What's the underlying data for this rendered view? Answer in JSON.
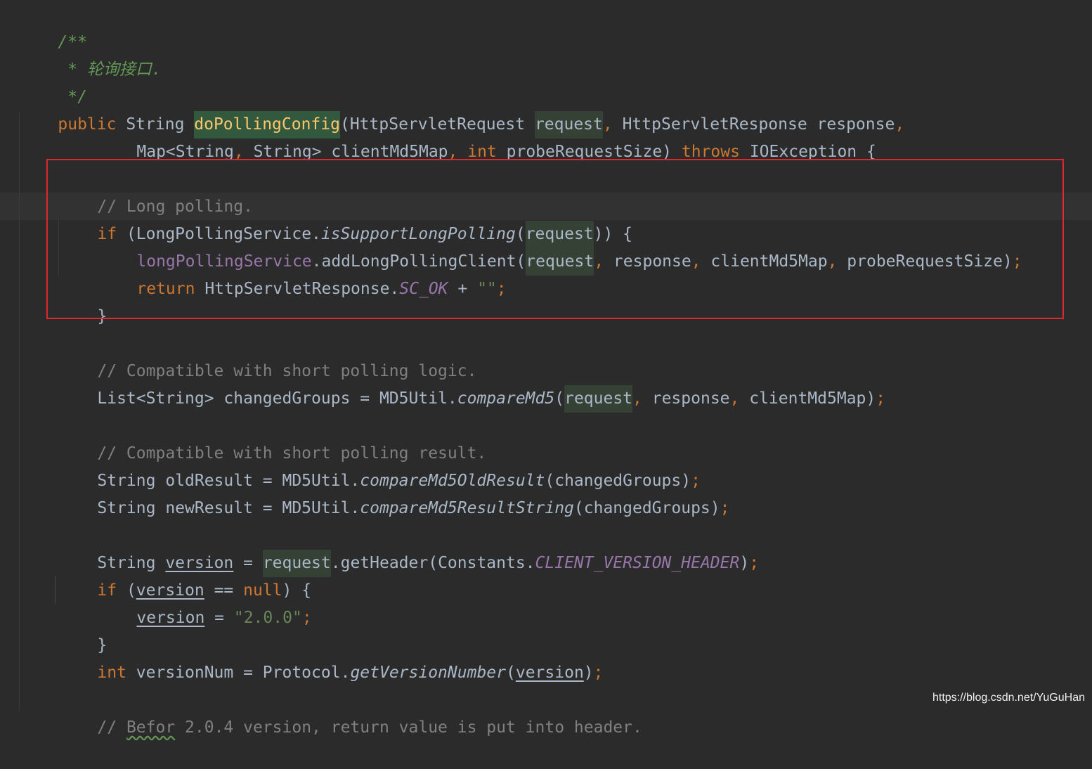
{
  "code": {
    "doc_open": "/**",
    "doc_desc": " * 轮询接口.",
    "doc_close": " */",
    "sig1": {
      "public": "public",
      "string_type": " String ",
      "method": "doPollingConfig",
      "open": "(HttpServletRequest ",
      "request": "request",
      "comma1": ",",
      "resp_type": " HttpServletResponse response",
      "comma2": ","
    },
    "sig2": {
      "map": "Map<String",
      "comma1": ",",
      "string": " String> clientMd5Map",
      "comma2": ",",
      "int": " int",
      "probe": " probeRequestSize) ",
      "throws": "throws",
      "tail": " IOException {"
    },
    "lp_comment": "// Long polling.",
    "lp_if": {
      "if": "if",
      "open": " (LongPollingService.",
      "call": "isSupportLongPolling",
      "paren": "(",
      "request": "request",
      "close": ")) {"
    },
    "lp_add": {
      "field": "longPollingService",
      "call": ".addLongPollingClient(",
      "request": "request",
      "c1": ",",
      "a1": " response",
      "c2": ",",
      "a2": " clientMd5Map",
      "c3": ",",
      "a3": " probeRequestSize)",
      "semi": ";"
    },
    "lp_return": {
      "return": "return",
      "mid": " HttpServletResponse.",
      "sc_ok": "SC_OK",
      "plus": " + ",
      "str": "\"\"",
      "semi": ";"
    },
    "lp_close": "}",
    "compat_comment": "// Compatible with short polling logic.",
    "changed": {
      "lhs": "List<String> changedGroups = MD5Util.",
      "call": "compareMd5",
      "paren": "(",
      "request": "request",
      "c1": ",",
      "a1": " response",
      "c2": ",",
      "a2": " clientMd5Map)",
      "semi": ";"
    },
    "result_comment": "// Compatible with short polling result.",
    "old_result": {
      "lhs": "String oldResult = MD5Util.",
      "call": "compareMd5OldResult",
      "args": "(changedGroups)",
      "semi": ";"
    },
    "new_result": {
      "lhs": "String newResult = MD5Util.",
      "call": "compareMd5ResultString",
      "args": "(changedGroups)",
      "semi": ";"
    },
    "version_decl": {
      "type": "String ",
      "var": "version",
      "eq": " = ",
      "request": "request",
      "call": ".getHeader(Constants.",
      "const": "CLIENT_VERSION_HEADER",
      "close": ")",
      "semi": ";"
    },
    "version_if": {
      "if": "if",
      "open": " (",
      "var": "version",
      "eq": " == ",
      "null": "null",
      "close": ") {"
    },
    "version_assign": {
      "var": "version",
      "eq": " = ",
      "str": "\"2.0.0\"",
      "semi": ";"
    },
    "version_close": "}",
    "version_num": {
      "int": "int",
      "lhs": " versionNum = Protocol.",
      "call": "getVersionNumber",
      "paren": "(",
      "var": "version",
      "close": ")",
      "semi": ";"
    },
    "befor_comment": {
      "slashes": "// ",
      "befor": "Befor",
      "rest": " 2.0.4 version, return value is put into header."
    }
  },
  "watermark": "https://blog.csdn.net/YuGuHan"
}
